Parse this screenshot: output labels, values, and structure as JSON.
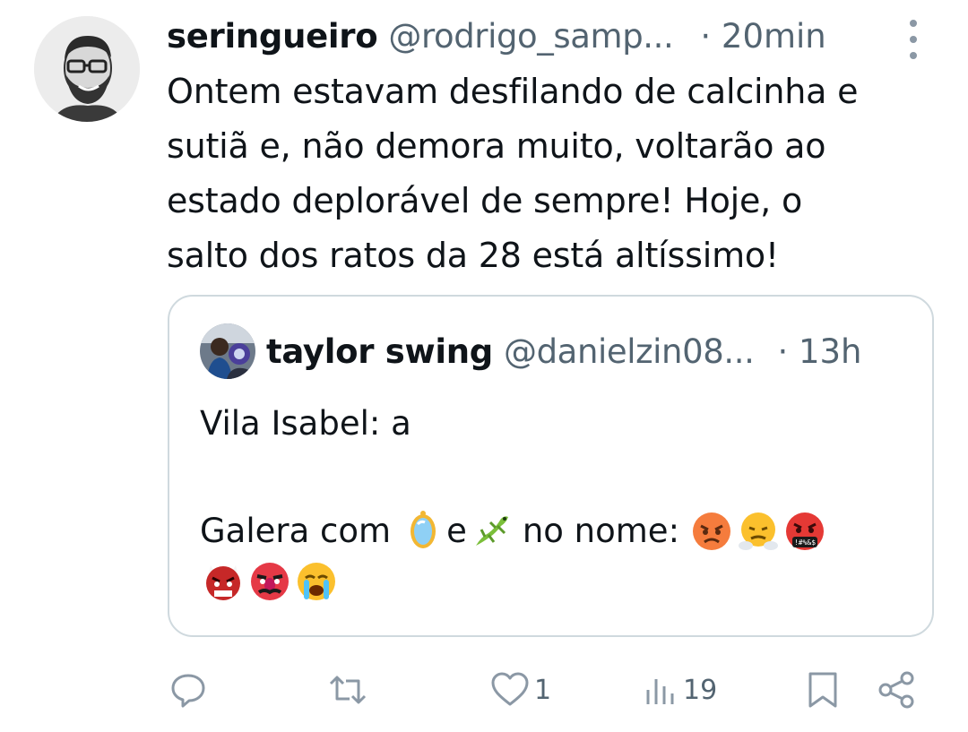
{
  "tweet": {
    "author": {
      "display_name": "seringueiro",
      "handle": "@rodrigo_samp...",
      "time": "· 20min"
    },
    "text_lines": [
      "Ontem estavam desfilando de calcinha e",
      "sutiã e, não demora muito, voltarão ao",
      "estado deplorável de sempre! Hoje, o",
      "salto dos ratos da 28 está altíssimo!"
    ],
    "quote": {
      "display_name": "taylor swing",
      "handle": "@danielzin08...",
      "time": "· 13h",
      "line1": "Vila Isabel: a",
      "line2_prefix": "Galera com",
      "line2_mid": "e",
      "line2_suffix": "no nome:",
      "emojis": [
        "mirror",
        "lizard",
        "angry-face",
        "face-with-steam",
        "face-with-symbols",
        "ogre",
        "goblin",
        "loudly-crying-face"
      ]
    },
    "actions": {
      "reply_count": "",
      "retweet_count": "",
      "like_count": "1",
      "views_count": "19"
    }
  },
  "colors": {
    "text": "#0f1419",
    "secondary": "#536471",
    "border": "#cfd9de",
    "icon": "#8b98a5"
  },
  "icons": [
    "more-vertical-icon",
    "reply-icon",
    "retweet-icon",
    "like-icon",
    "views-icon",
    "bookmark-icon",
    "share-icon"
  ]
}
